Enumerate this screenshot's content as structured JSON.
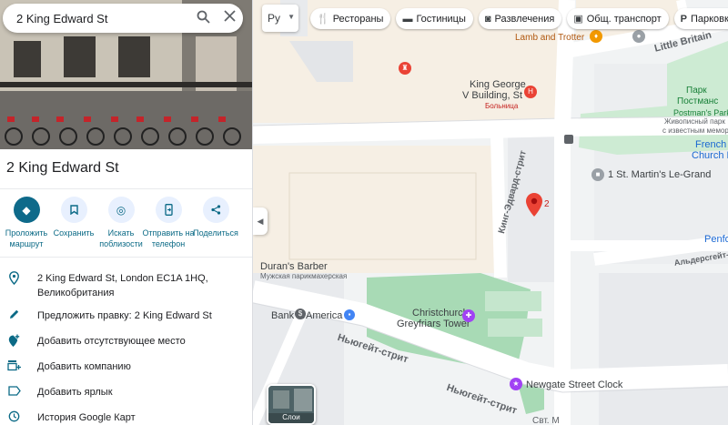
{
  "search": {
    "query": "2 King Edward St"
  },
  "place": {
    "title": "2 King Edward St"
  },
  "actions": [
    {
      "icon": "directions-icon",
      "label": "Проложить маршрут"
    },
    {
      "icon": "bookmark-icon",
      "label": "Сохранить"
    },
    {
      "icon": "nearby-icon",
      "label": "Искать поблизости"
    },
    {
      "icon": "send-to-phone-icon",
      "label": "Отправить на телефон"
    },
    {
      "icon": "share-icon",
      "label": "Поделиться"
    }
  ],
  "info": [
    {
      "icon": "location-pin-icon",
      "text": "2 King Edward St, London EC1A 1HQ, Великобритания"
    },
    {
      "icon": "pencil-icon",
      "text": "Предложить правку: 2 King Edward St"
    },
    {
      "icon": "add-place-icon",
      "text": "Добавить отсутствующее место"
    },
    {
      "icon": "add-business-icon",
      "text": "Добавить компанию"
    },
    {
      "icon": "label-icon",
      "text": "Добавить ярлык"
    },
    {
      "icon": "history-icon",
      "text": "История Google Карт"
    }
  ],
  "map": {
    "language_button": "Ру",
    "chips": [
      {
        "icon": "restaurant-icon",
        "label": "Рестораны"
      },
      {
        "icon": "hotel-icon",
        "label": "Гостиницы"
      },
      {
        "icon": "camera-icon",
        "label": "Развлечения"
      },
      {
        "icon": "transit-icon",
        "label": "Общ. транспорт"
      },
      {
        "icon": "parking-icon",
        "label": "Парковка"
      }
    ],
    "labels": {
      "lamb_trotter": "Lamb and Trotter",
      "little_britain": "Little Britain",
      "park_1": "Парк",
      "park_2": "Постманс",
      "postmans_park_1": "Postman's Park",
      "postmans_park_2": "Живописный парк",
      "postmans_park_3": "с известным мемориалом",
      "king_george_1": "King George",
      "king_george_2": "V Building, St",
      "king_george_3": "Больница",
      "french": "French I",
      "church": "Church B",
      "st_martins": "1 St. Martin's Le-Grand",
      "king_edward_street": "Кинг-Эдвард-стрит",
      "durans_1": "Duran's Barber",
      "durans_2": "Мужская парикмахерская",
      "christchurch_1": "Christchurch",
      "christchurch_2": "Greyfriars Tower",
      "bank_of": "Bank of",
      "america": "America",
      "newgate_1": "Ньюгейт-стрит",
      "newgate_2": "Ньюгейт-стрит",
      "newgate_clock": "Newgate Street Clock",
      "penfo": "Penfo",
      "aldersgate": "Альдерсгейт-стрит",
      "pin_number": "2",
      "layers": "Слои",
      "bottom_fragment": "Свт. М"
    }
  }
}
